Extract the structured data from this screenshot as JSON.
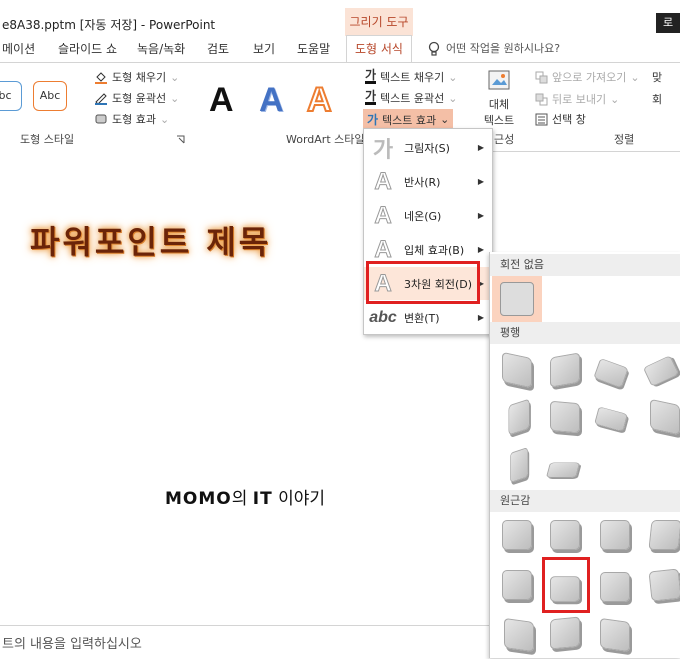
{
  "titlebar": {
    "title": "e8A38.pptm [자동 저장]  -  PowerPoint",
    "context_tab": "그리기 도구",
    "user": "로"
  },
  "tabs": [
    "메이션",
    "슬라이드 쇼",
    "녹음/녹화",
    "검토",
    "보기",
    "도움말",
    "도형 서식"
  ],
  "tell_me": "어떤 작업을 원하시나요?",
  "ribbon": {
    "shape_samples": [
      "bc",
      "Abc"
    ],
    "shape_fill": "도형 채우기",
    "shape_outline": "도형 윤곽선",
    "shape_effects": "도형 효과",
    "shape_styles_label": "도형 스타일",
    "wordart_letter": "A",
    "wordart_label": "WordArt 스타일",
    "text_fill": "텍스트 채우기",
    "text_outline": "텍스트 윤곽선",
    "text_effects": "텍스트 효과",
    "alt_text_line1": "대체",
    "alt_text_line2": "텍스트",
    "accessibility_partial": "근성",
    "bring_forward": "앞으로 가져오기",
    "send_backward": "뒤로 보내기",
    "selection_pane": "선택 창",
    "arrange_label": "정렬",
    "align_partial": "맞",
    "group_partial": "회"
  },
  "text_effects_menu": [
    {
      "glyph": "가",
      "label": "그림자(S)",
      "has_submenu": true
    },
    {
      "glyph": "A",
      "label": "반사(R)",
      "has_submenu": true
    },
    {
      "glyph": "A",
      "label": "네온(G)",
      "has_submenu": true
    },
    {
      "glyph": "A",
      "label": "입체 효과(B)",
      "has_submenu": true
    },
    {
      "glyph": "A",
      "label": "3차원 회전(D)",
      "has_submenu": true
    },
    {
      "glyph": "abc",
      "label": "변환(T)",
      "has_submenu": true
    }
  ],
  "rotation_gallery": {
    "no_rotation": "회전 없음",
    "parallel": "평행",
    "perspective": "원근감"
  },
  "slide": {
    "title": "파워포인트 제목",
    "subtitle_bold_1": "MOMO",
    "subtitle_mid": "의 ",
    "subtitle_bold_2": "IT",
    "subtitle_end": " 이야기"
  },
  "notes_placeholder": "트의 내용을 입력하십시오",
  "colors": {
    "accent": "#b7472a",
    "highlight": "#e02020",
    "contextual": "#fbe3d6"
  }
}
